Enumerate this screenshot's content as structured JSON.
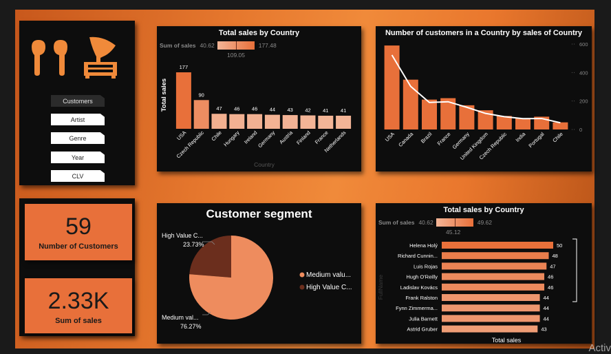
{
  "nav": {
    "items": [
      "Customers",
      "Artist",
      "Genre",
      "Year",
      "CLV"
    ],
    "active": 0
  },
  "kpis": {
    "customers": {
      "value": "59",
      "label": "Number of Customers"
    },
    "sales": {
      "value": "2.33K",
      "label": "Sum of sales"
    }
  },
  "charts": {
    "sales_country": {
      "title": "Total sales by Country",
      "legend_title": "Sum of sales",
      "legend_min": "40.62",
      "legend_mid": "109.05",
      "legend_max": "177.48",
      "ylabel": "Total sales",
      "xlabel": "Country"
    },
    "customers_country": {
      "title": "Number of customers in a Country by sales of Country"
    },
    "segment": {
      "title": "Customer segment",
      "legend": [
        "Medium valu...",
        "High Value C..."
      ]
    },
    "sales_customer": {
      "title": "Total sales by Country",
      "legend_title": "Sum of sales",
      "legend_min": "40.62",
      "legend_mid": "45.12",
      "legend_max": "49.62",
      "ylabel": "FullName",
      "xlabel": "Total sales"
    }
  },
  "chart_data": [
    {
      "type": "bar",
      "title": "Total sales by Country",
      "xlabel": "Country",
      "ylabel": "Total sales",
      "categories": [
        "USA",
        "Czech Republic",
        "Chile",
        "Hungary",
        "Ireland",
        "Germany",
        "Austria",
        "Finland",
        "France",
        "Netherlands"
      ],
      "values": [
        177,
        90,
        47,
        46,
        46,
        44,
        43,
        42,
        41,
        41
      ]
    },
    {
      "type": "bar",
      "title": "Number of customers in a Country by sales of Country",
      "categories": [
        "USA",
        "Canada",
        "Brazil",
        "France",
        "Germany",
        "United Kingdom",
        "Czech Republic",
        "India",
        "Portugal",
        "Chile"
      ],
      "values": [
        590,
        350,
        210,
        220,
        170,
        135,
        95,
        80,
        90,
        50
      ],
      "line_values": [
        523,
        303,
        190,
        195,
        156,
        113,
        90,
        76,
        77,
        47
      ],
      "y_ticks": [
        0,
        200,
        400,
        600
      ],
      "ylim": [
        0,
        600
      ]
    },
    {
      "type": "pie",
      "title": "Customer segment",
      "labels": [
        "High Value C...",
        "Medium val..."
      ],
      "values": [
        23.73,
        76.27
      ],
      "value_labels": [
        "23.73%",
        "76.27%"
      ],
      "colors": [
        "#6b2e1d",
        "#ee8c5e"
      ]
    },
    {
      "type": "bar",
      "title": "Total sales by Country",
      "xlabel": "Total sales",
      "ylabel": "FullName",
      "categories": [
        "Helena Holý",
        "Richard Cunnin...",
        "Luis Rojas",
        "Hugh O'Reilly",
        "Ladislav Kovács",
        "Frank Ralston",
        "Fynn Zimmerma...",
        "Julia Barnett",
        "Astrid Gruber"
      ],
      "values": [
        50,
        48,
        47,
        46,
        46,
        44,
        44,
        44,
        43
      ]
    }
  ],
  "colors": {
    "accent": "#e8703a",
    "dark_accent": "#6b2e1d",
    "light_accent": "#f3b597",
    "line": "#ffffff"
  },
  "watermark": "Activ"
}
